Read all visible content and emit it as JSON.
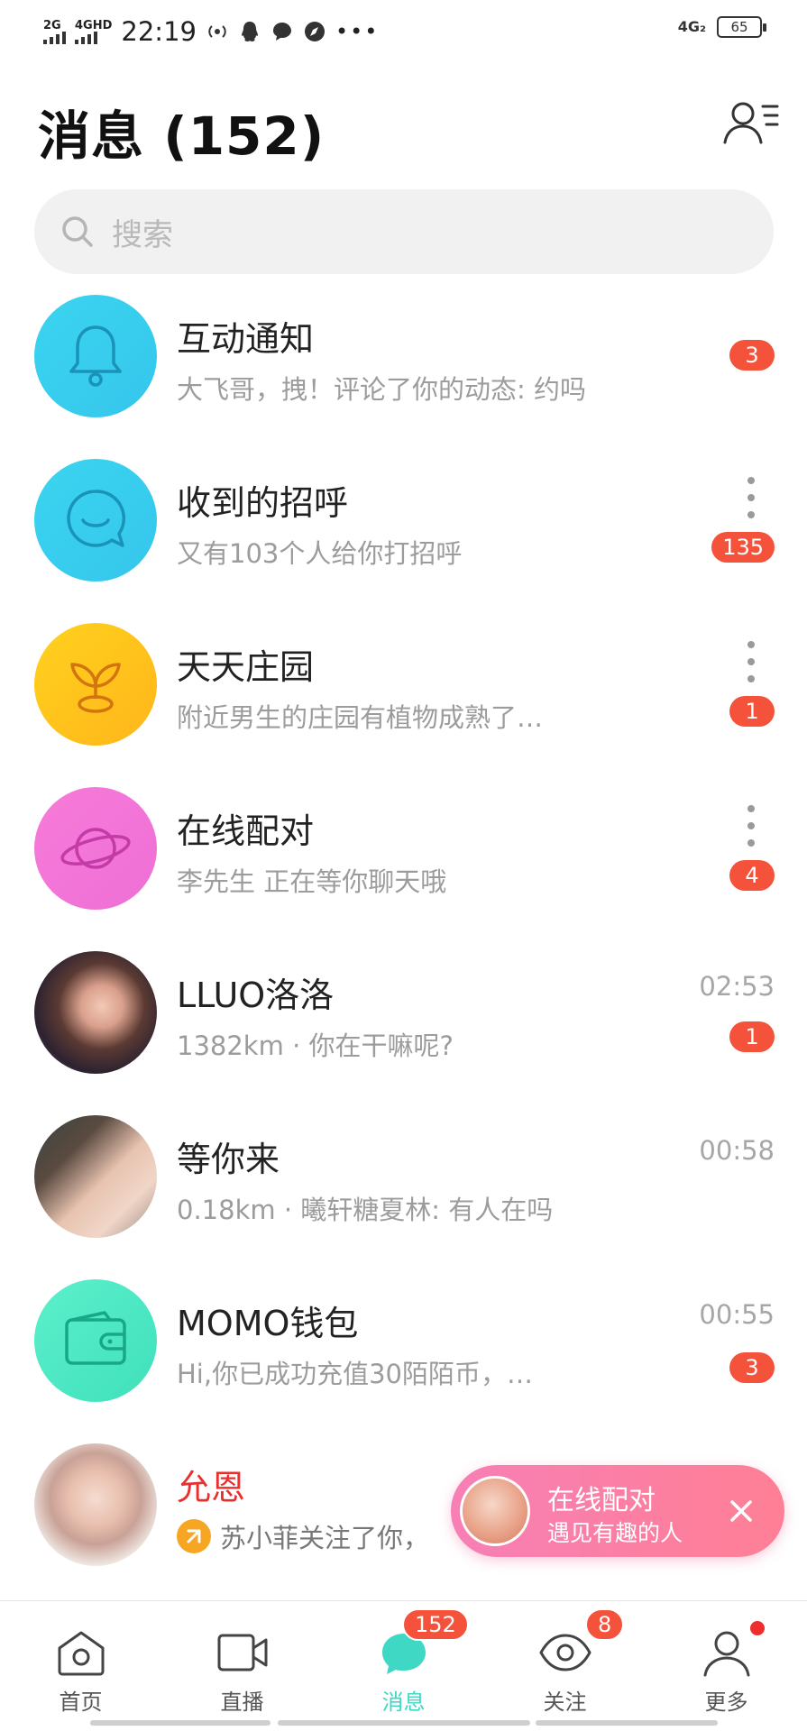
{
  "status_bar": {
    "net1": "2G",
    "net2": "4GHD",
    "time": "22:19",
    "net_right": "4G₂",
    "battery": "65"
  },
  "header": {
    "title": "消息 (152)"
  },
  "search": {
    "placeholder": "搜索"
  },
  "items": [
    {
      "title": "互动通知",
      "subtitle": "大飞哥，拽！评论了你的动态: 约吗",
      "badge": "3",
      "icon": "bell-icon",
      "color": "#38d0f0"
    },
    {
      "title": "收到的招呼",
      "subtitle": "又有103个人给你打招呼",
      "badge": "135",
      "icon": "chat-smile-icon",
      "color": "#38d0f0"
    },
    {
      "title": "天天庄园",
      "subtitle": "附近男生的庄园有植物成熟了…",
      "badge": "1",
      "icon": "sprout-icon",
      "color": "#ffc21a"
    },
    {
      "title": "在线配对",
      "subtitle": "李先生 正在等你聊天哦",
      "badge": "4",
      "icon": "planet-icon",
      "color": "#f57de0"
    },
    {
      "title": "LLUO洛洛",
      "subtitle": "1382km · 你在干嘛呢?",
      "time": "02:53",
      "badge": "1"
    },
    {
      "title": "等你来",
      "subtitle": "0.18km · 曦轩糖夏林: 有人在吗",
      "time": "00:58"
    },
    {
      "title": "MOMO钱包",
      "subtitle": "Hi,你已成功充值30陌陌币，…",
      "time": "00:55",
      "badge": "3",
      "icon": "wallet-icon",
      "color": "#4ee8c2"
    },
    {
      "title": "允恩",
      "subtitle": "苏小菲关注了你，"
    }
  ],
  "banner": {
    "title": "在线配对",
    "subtitle": "遇见有趣的人"
  },
  "tabbar": {
    "tabs": [
      {
        "label": "首页"
      },
      {
        "label": "直播"
      },
      {
        "label": "消息",
        "badge": "152"
      },
      {
        "label": "关注",
        "badge": "8"
      },
      {
        "label": "更多"
      }
    ]
  }
}
